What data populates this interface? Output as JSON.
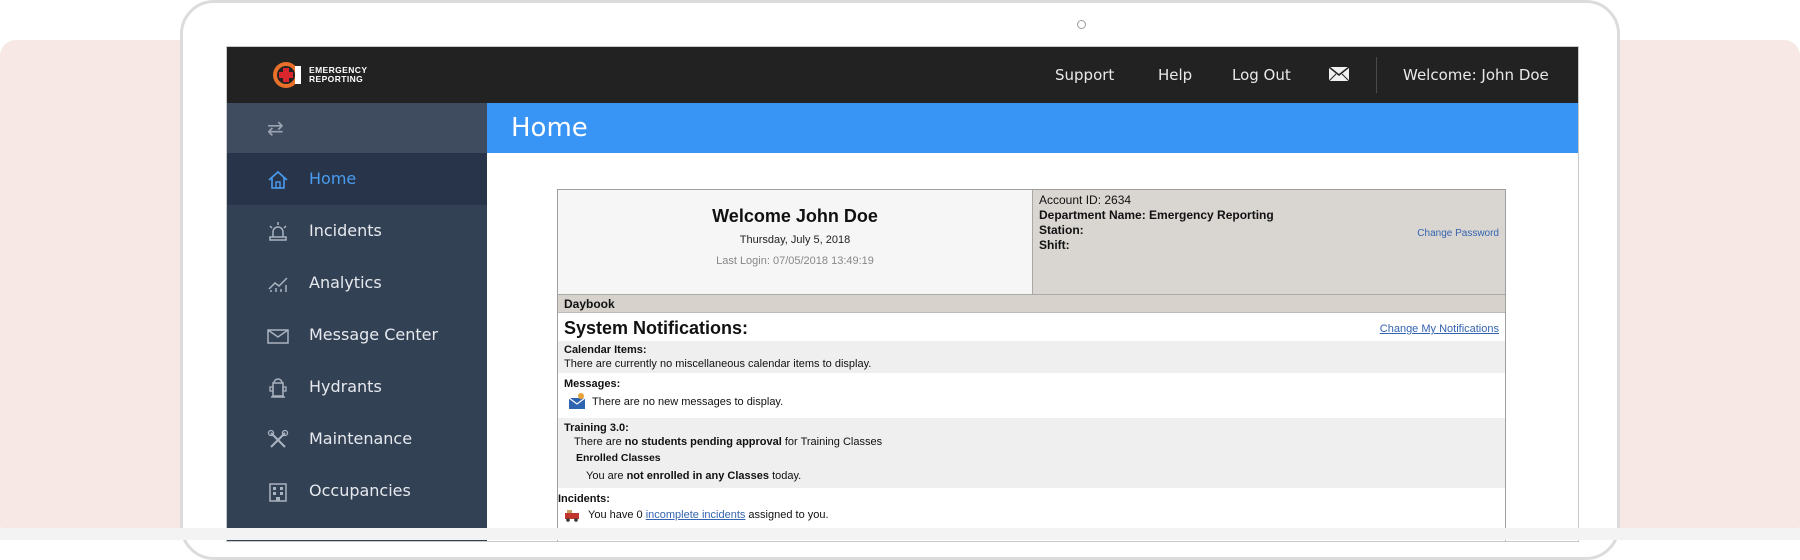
{
  "brand": {
    "logo_line1": "EMERGENCY",
    "logo_line2": "REPORTING"
  },
  "topbar": {
    "links": [
      "Support",
      "Help",
      "Log Out"
    ],
    "mail_icon": "mail-icon",
    "welcome": "Welcome: John Doe"
  },
  "sidebar": {
    "toggle_icon": "swap-arrows-icon",
    "items": [
      {
        "label": "Home",
        "icon": "home-icon",
        "active": true
      },
      {
        "label": "Incidents",
        "icon": "siren-icon"
      },
      {
        "label": "Analytics",
        "icon": "chart-icon"
      },
      {
        "label": "Message Center",
        "icon": "envelope-icon"
      },
      {
        "label": "Hydrants",
        "icon": "hydrant-icon"
      },
      {
        "label": "Maintenance",
        "icon": "wrench-icon"
      },
      {
        "label": "Occupancies",
        "icon": "building-icon"
      }
    ]
  },
  "header": {
    "title": "Home"
  },
  "welcome": {
    "title": "Welcome John Doe",
    "date": "Thursday, July 5, 2018",
    "last_login": "Last Login: 07/05/2018 13:49:19"
  },
  "account": {
    "account_id": "Account ID: 2634",
    "department": "Department Name: Emergency Reporting",
    "station": "Station:",
    "shift": "Shift:",
    "change_password": "Change Password"
  },
  "daybook": {
    "label": "Daybook"
  },
  "notifications": {
    "title": "System Notifications:",
    "change_link": "Change My Notifications",
    "calendar_heading": "Calendar Items:",
    "calendar_text": "There are currently no miscellaneous calendar items to display.",
    "messages_heading": "Messages:",
    "messages_text": "There are no new messages to display.",
    "training_heading": "Training 3.0:",
    "training_pre": "There are ",
    "training_bold": "no students pending approval",
    "training_post": " for Training Classes",
    "enrolled_heading": "Enrolled Classes",
    "enrolled_pre": "You are ",
    "enrolled_bold": "not enrolled in any Classes",
    "enrolled_post": " today.",
    "incidents_heading": "Incidents:",
    "incidents_pre": "You have 0 ",
    "incidents_link": "incomplete incidents",
    "incidents_post": " assigned to you."
  }
}
